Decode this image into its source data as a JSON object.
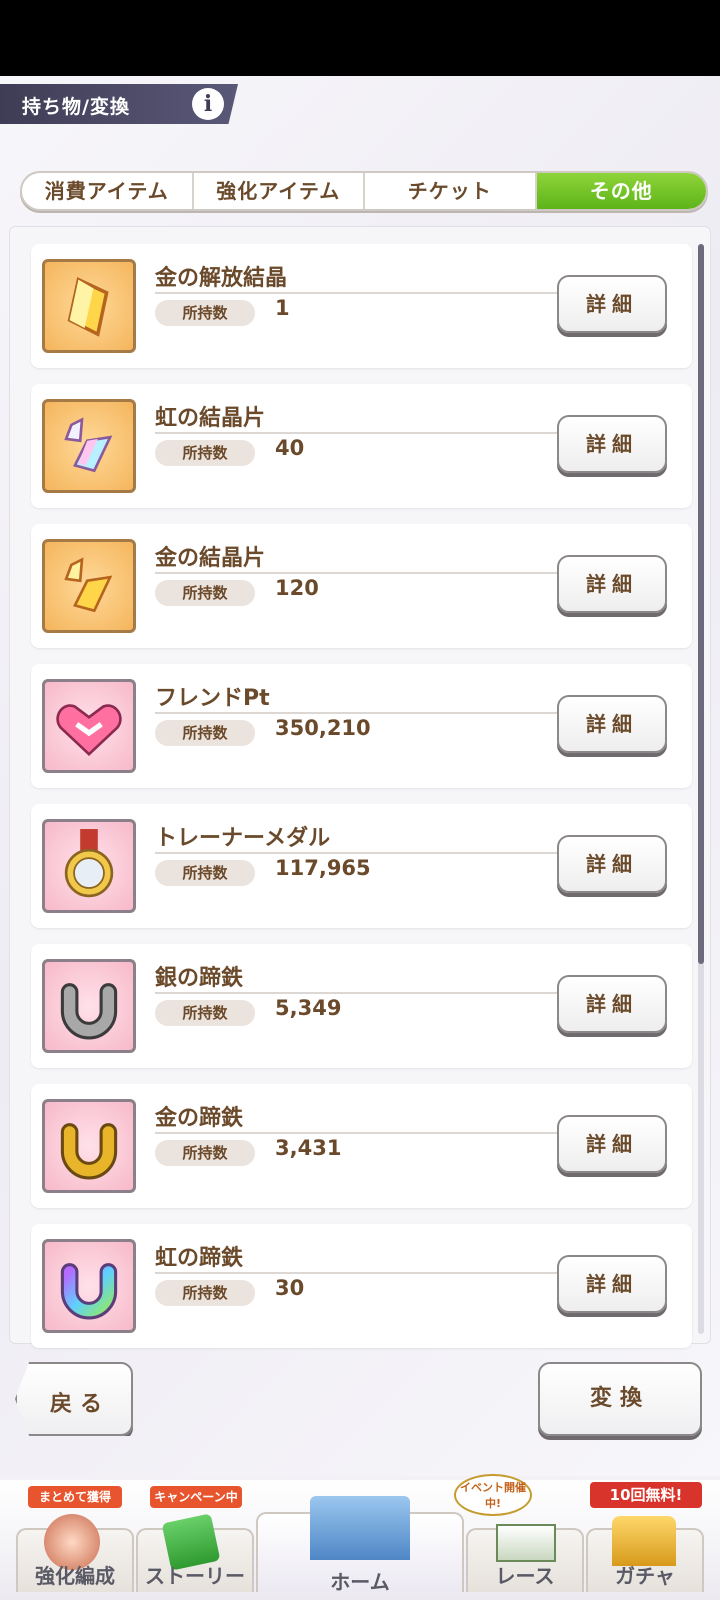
{
  "header": {
    "title": "持ち物/変換",
    "info_icon": "info-icon"
  },
  "tabs": [
    {
      "label": "消費アイテム",
      "active": false
    },
    {
      "label": "強化アイテム",
      "active": false
    },
    {
      "label": "チケット",
      "active": false
    },
    {
      "label": "その他",
      "active": true
    }
  ],
  "items": [
    {
      "name": "金の解放結晶",
      "own_label": "所持数",
      "count": "1",
      "icon": "gold-release-crystal-icon",
      "frame": "gold",
      "detail_label": "詳細"
    },
    {
      "name": "虹の結晶片",
      "own_label": "所持数",
      "count": "40",
      "icon": "rainbow-crystal-shard-icon",
      "frame": "gold",
      "detail_label": "詳細"
    },
    {
      "name": "金の結晶片",
      "own_label": "所持数",
      "count": "120",
      "icon": "gold-crystal-shard-icon",
      "frame": "gold",
      "detail_label": "詳細"
    },
    {
      "name": "フレンドPt",
      "own_label": "所持数",
      "count": "350,210",
      "icon": "handshake-icon",
      "frame": "pink",
      "detail_label": "詳細"
    },
    {
      "name": "トレーナーメダル",
      "own_label": "所持数",
      "count": "117,965",
      "icon": "medal-icon",
      "frame": "pink",
      "detail_label": "詳細"
    },
    {
      "name": "銀の蹄鉄",
      "own_label": "所持数",
      "count": "5,349",
      "icon": "silver-horseshoe-icon",
      "frame": "pink",
      "detail_label": "詳細"
    },
    {
      "name": "金の蹄鉄",
      "own_label": "所持数",
      "count": "3,431",
      "icon": "gold-horseshoe-icon",
      "frame": "pink",
      "detail_label": "詳細"
    },
    {
      "name": "虹の蹄鉄",
      "own_label": "所持数",
      "count": "30",
      "icon": "rainbow-horseshoe-icon",
      "frame": "pink",
      "detail_label": "詳細"
    }
  ],
  "actions": {
    "back_label": "戻る",
    "convert_label": "変換"
  },
  "nav": [
    {
      "label": "強化編成",
      "badge": "まとめて獲得",
      "icon": "character-icon"
    },
    {
      "label": "ストーリー",
      "badge": "キャンペーン中",
      "icon": "story-book-icon"
    },
    {
      "label": "ホーム",
      "badge": "",
      "icon": "school-building-icon"
    },
    {
      "label": "レース",
      "badge": "イベント開催中!",
      "icon": "race-gate-icon"
    },
    {
      "label": "ガチャ",
      "badge": "10回無料!",
      "icon": "gacha-gate-icon"
    }
  ]
}
